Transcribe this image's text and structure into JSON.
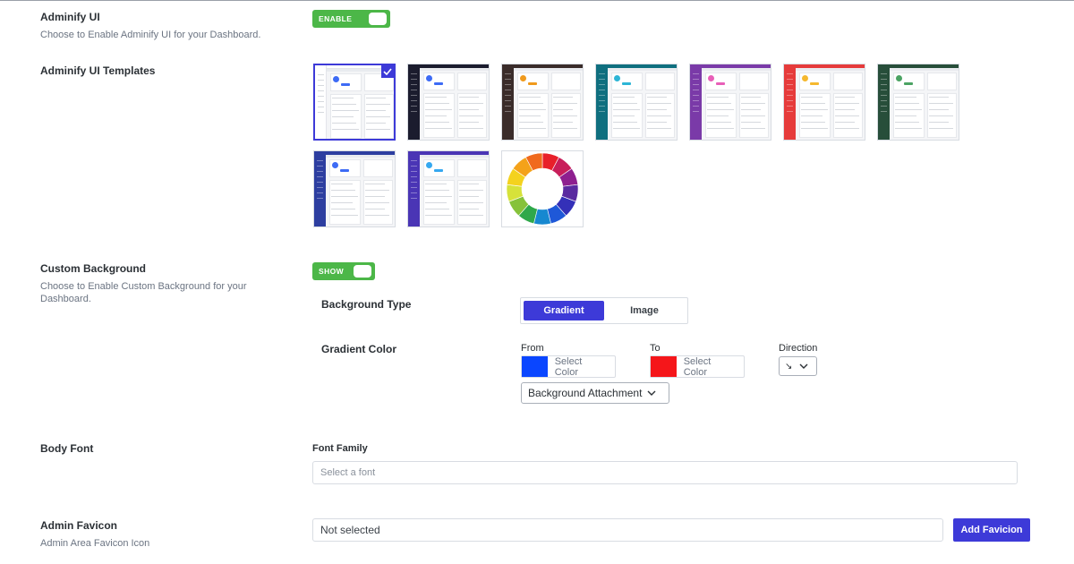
{
  "adminify_ui": {
    "title": "Adminify UI",
    "description": "Choose to Enable Adminify UI for your Dashboard.",
    "toggle_label": "ENABLE"
  },
  "templates": {
    "title": "Adminify UI Templates",
    "items": [
      {
        "name": "light",
        "sidebar": "#ffffff",
        "top": "#ffffff",
        "accent": "#3d6bf5",
        "selected": true
      },
      {
        "name": "dark",
        "sidebar": "#1b1c2e",
        "top": "#1b1c2e",
        "accent": "#3d6bf5",
        "selected": false
      },
      {
        "name": "brown",
        "sidebar": "#3a2c2a",
        "top": "#3a2c2a",
        "accent": "#f09a1c",
        "selected": false
      },
      {
        "name": "teal",
        "sidebar": "#0f6f7f",
        "top": "#0f6f7f",
        "accent": "#2db5d6",
        "selected": false
      },
      {
        "name": "purple",
        "sidebar": "#7a3aa8",
        "top": "#7a3aa8",
        "accent": "#e85fb8",
        "selected": false
      },
      {
        "name": "red",
        "sidebar": "#e63b3b",
        "top": "#e63b3b",
        "accent": "#f5b82e",
        "selected": false
      },
      {
        "name": "green",
        "sidebar": "#274e3a",
        "top": "#274e3a",
        "accent": "#4ba363",
        "selected": false
      },
      {
        "name": "blue",
        "sidebar": "#2d3ea0",
        "top": "#2d3ea0",
        "accent": "#3d6bf5",
        "selected": false
      },
      {
        "name": "violet",
        "sidebar": "#4a35b5",
        "top": "#4a35b5",
        "accent": "#35a8f0",
        "selected": false
      },
      {
        "name": "custom-color-wheel",
        "custom": true,
        "selected": false
      }
    ]
  },
  "custom_background": {
    "title": "Custom Background",
    "description": "Choose to Enable Custom Background for your Dashboard.",
    "toggle_label": "SHOW",
    "background_type_label": "Background Type",
    "type_options": [
      "Gradient",
      "Image"
    ],
    "active_type": "Gradient",
    "gradient_color_label": "Gradient Color",
    "from_label": "From",
    "to_label": "To",
    "direction_label": "Direction",
    "select_color": "Select Color",
    "from_color": "#0a46ff",
    "to_color": "#f5161a",
    "direction_value": "↘",
    "attachment_label": "Background Attachment"
  },
  "body_font": {
    "title": "Body Font",
    "font_family_label": "Font Family",
    "placeholder": "Select a font"
  },
  "admin_favicon": {
    "title": "Admin Favicon",
    "description": "Admin Area Favicon Icon",
    "value": "Not selected",
    "button_label": "Add Favicion"
  },
  "colors": {
    "accent": "#3d3ad8",
    "toggle_on": "#4cb748"
  }
}
